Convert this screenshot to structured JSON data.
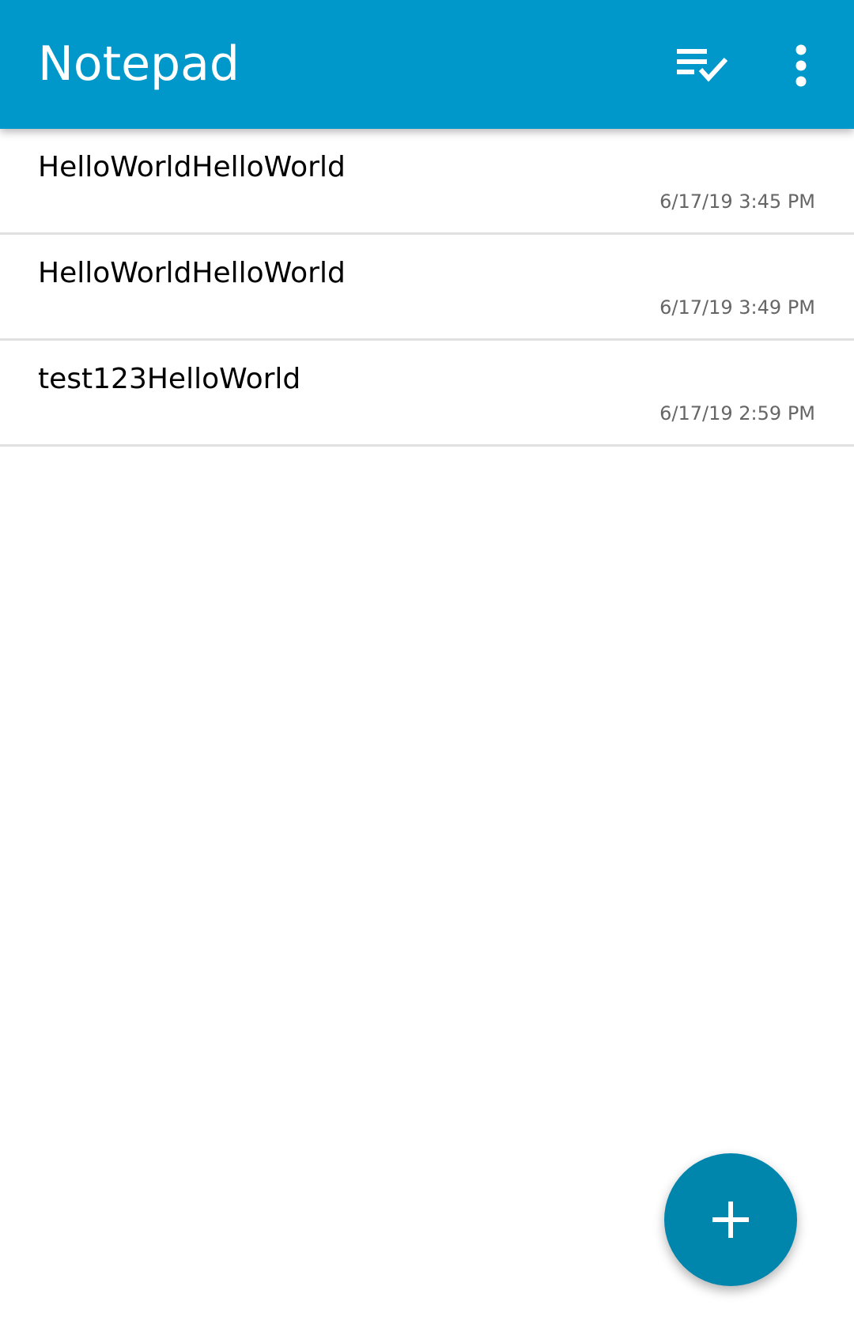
{
  "app_bar": {
    "title": "Notepad",
    "background_color": "#0098cb",
    "actions": [
      {
        "icon": "playlist-check-icon"
      },
      {
        "icon": "more-vert-icon"
      }
    ]
  },
  "notes": [
    {
      "title": "HelloWorldHelloWorld",
      "date": "6/17/19 3:45 PM"
    },
    {
      "title": "HelloWorldHelloWorld",
      "date": "6/17/19 3:49 PM"
    },
    {
      "title": "test123HelloWorld",
      "date": "6/17/19 2:59 PM"
    }
  ],
  "fab": {
    "icon": "add-icon",
    "color": "#0085ad"
  }
}
